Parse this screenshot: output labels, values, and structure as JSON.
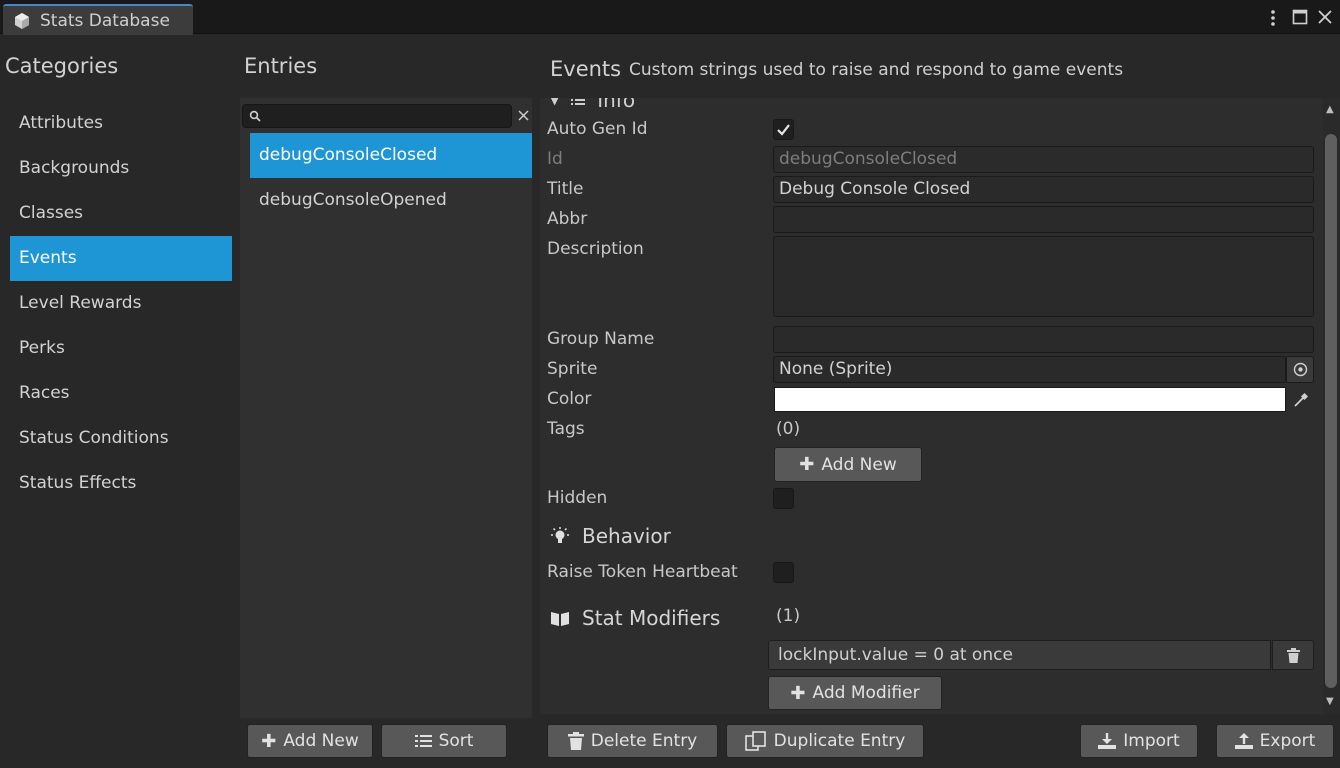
{
  "window": {
    "tab_title": "Stats Database",
    "menu_icon": "kebab-menu-icon",
    "maximize_icon": "maximize-icon",
    "close_icon": "close-icon"
  },
  "categories": {
    "header": "Categories",
    "items": [
      "Attributes",
      "Backgrounds",
      "Classes",
      "Events",
      "Level Rewards",
      "Perks",
      "Races",
      "Status Conditions",
      "Status Effects"
    ],
    "selected": "Events"
  },
  "entries": {
    "header": "Entries",
    "search_value": "",
    "items": [
      "debugConsoleClosed",
      "debugConsoleOpened"
    ],
    "selected": "debugConsoleClosed"
  },
  "details": {
    "title": "Events",
    "subtitle": "Custom strings used to raise and respond to game events",
    "info_section": "Info",
    "fields": {
      "auto_gen_id": {
        "label": "Auto Gen Id",
        "checked": true
      },
      "id": {
        "label": "Id",
        "value": "debugConsoleClosed"
      },
      "title": {
        "label": "Title",
        "value": "Debug Console Closed"
      },
      "abbr": {
        "label": "Abbr",
        "value": ""
      },
      "description": {
        "label": "Description",
        "value": ""
      },
      "group_name": {
        "label": "Group Name",
        "value": ""
      },
      "sprite": {
        "label": "Sprite",
        "value": "None (Sprite)"
      },
      "color": {
        "label": "Color",
        "value": "#ffffff"
      },
      "tags": {
        "label": "Tags",
        "count": "(0)",
        "add_label": "Add New"
      },
      "hidden": {
        "label": "Hidden",
        "checked": false
      }
    },
    "behavior": {
      "header": "Behavior",
      "raise_token_heartbeat": {
        "label": "Raise Token Heartbeat",
        "checked": false
      }
    },
    "stat_modifiers": {
      "header": "Stat Modifiers",
      "count": "(1)",
      "items": [
        "lockInput.value = 0 at once"
      ],
      "add_label": "Add Modifier"
    }
  },
  "toolbar": {
    "add_new": "Add New",
    "sort": "Sort",
    "delete_entry": "Delete Entry",
    "duplicate_entry": "Duplicate Entry",
    "import": "Import",
    "export": "Export"
  },
  "colors": {
    "accent": "#1e96d6",
    "background": "#282828",
    "button": "#585858"
  }
}
